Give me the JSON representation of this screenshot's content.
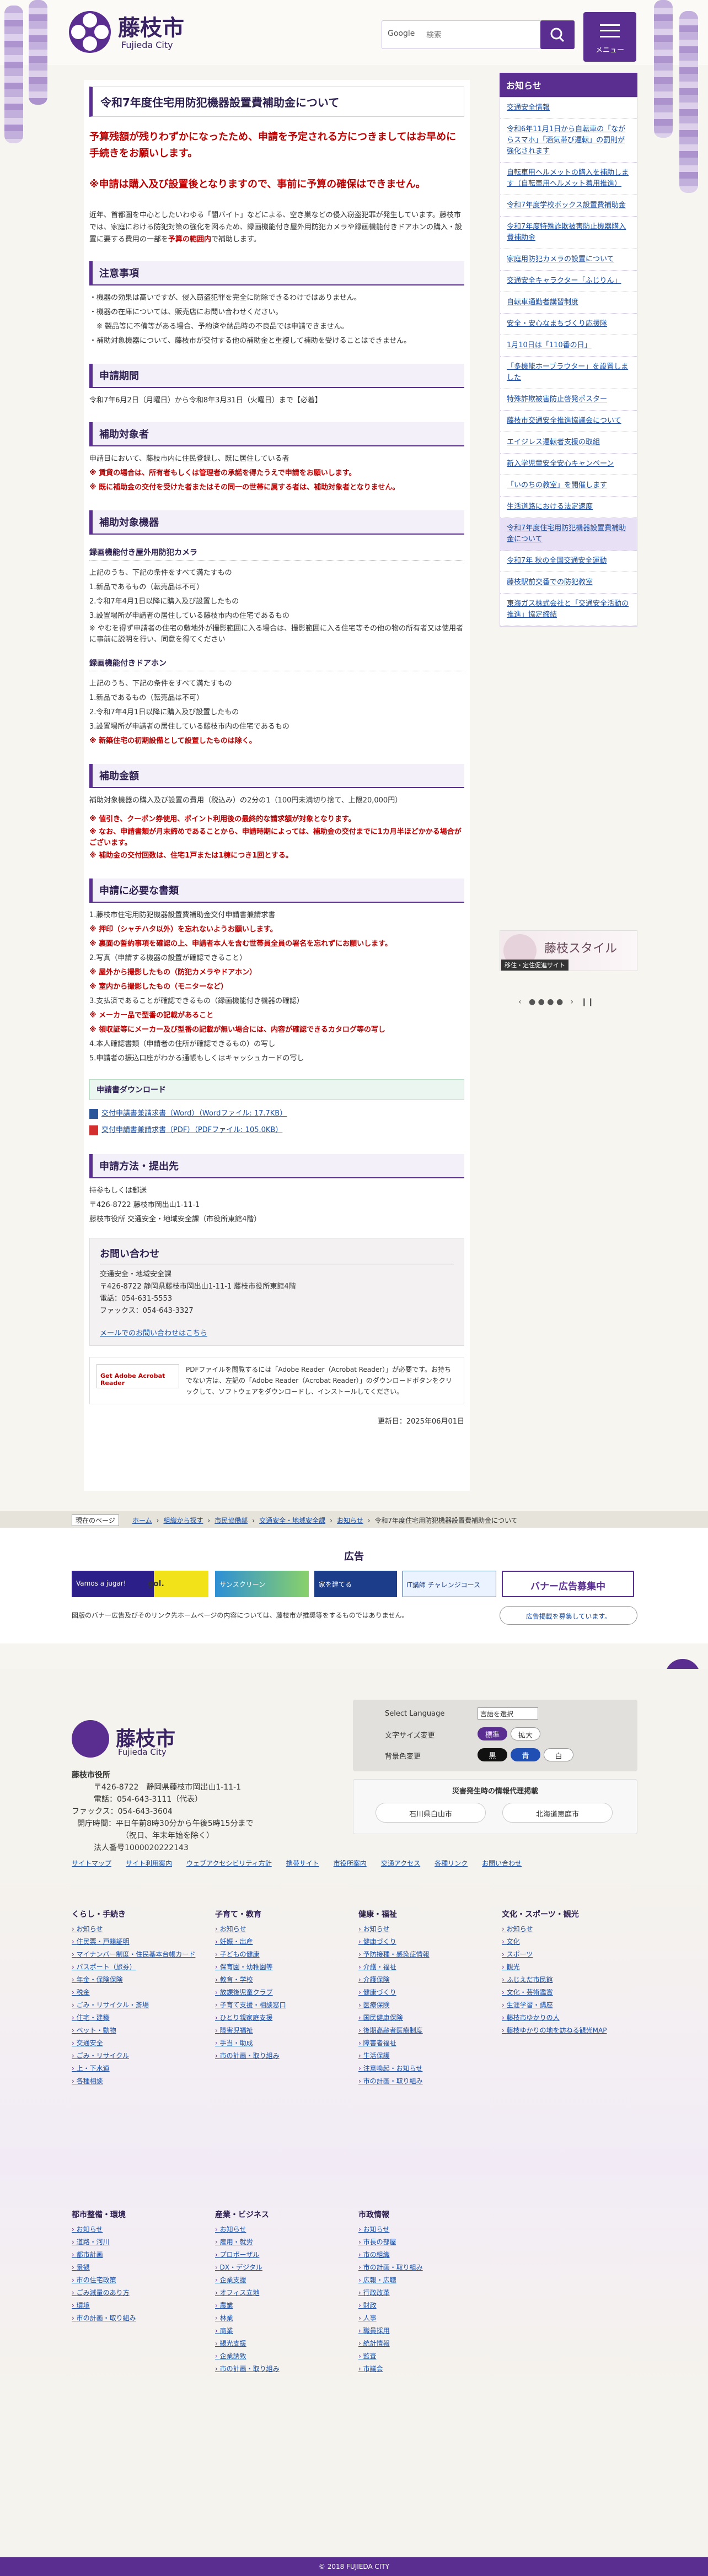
{
  "header": {
    "site_name": "藤枝市",
    "site_name_en": "Fujieda City",
    "search_label": "Google",
    "search_placeholder": "検索",
    "menu_label": "メニュー"
  },
  "article": {
    "title": "令和7年度住宅用防犯機器設置費補助金について",
    "warning1": "予算残額が残りわずかになったため、申請を予定される方につきましてはお早めに手続きをお願いします。",
    "warning2": "※申請は購入及び設置後となりますので、事前に予算の確保はできません。",
    "intro": "近年、首都圏を中心としたいわゆる「闇バイト」などによる、空き巣などの侵入窃盗犯罪が発生しています。藤枝市では、家庭における防犯対策の強化を図るため、録画機能付き屋外用防犯カメラや録画機能付きドアホンの購入・設置に要する費用の一部を",
    "intro_red": "予算の範囲内",
    "intro_end": "で補助します。",
    "caution_h": "注意事項",
    "caution": [
      "・機器の効果は高いですが、侵入窃盗犯罪を完全に防除できるわけではありません。",
      "・機器の在庫については、販売店にお問い合わせください。",
      "　※ 製品等に不備等がある場合、予約済や納品時の不良品では申請できません。",
      "・補助対象機器について、藤枝市が交付する他の補助金と重複して補助を受けることはできません。"
    ],
    "period_h": "申請期間",
    "period": "令和7年6月2日（月曜日）から令和8年3月31日（火曜日）まで【必着】",
    "target_h": "補助対象者",
    "target": [
      "申請日において、藤枝市内に住民登録し、既に居住している者",
      "※ 賃貸の場合は、所有者もしくは管理者の承諾を得たうえで申請をお願いします。",
      "※ 既に補助金の交付を受けた者またはその同一の世帯に属する者は、補助対象者となりません。"
    ],
    "device_h": "補助対象機器",
    "camera_h": "録画機能付き屋外用防犯カメラ",
    "camera": [
      "上記のうち、下記の条件をすべて満たすもの",
      "1.新品であるもの（転売品は不可）",
      "2.令和7年4月1日以降に購入及び設置したもの",
      "3.設置場所が申請者の居住している藤枝市内の住宅であるもの",
      "※ やむを得ず申請者の住宅の敷地外が撮影範囲に入る場合は、撮影範囲に入る住宅等その他の物の所有者又は使用者に事前に説明を行い、同意を得てください"
    ],
    "door_h": "録画機能付きドアホン",
    "door": [
      "上記のうち、下記の条件をすべて満たすもの",
      "1.新品であるもの（転売品は不可）",
      "2.令和7年4月1日以降に購入及び設置したもの",
      "3.設置場所が申請者の居住している藤枝市内の住宅であるもの"
    ],
    "door_red": "※ 新築住宅の初期設備として設置したものは除く。",
    "amount_h": "補助金額",
    "amount": "補助対象機器の購入及び設置の費用（税込み）の2分の1（100円未満切り捨て、上限20,000円）",
    "amount_notes": [
      "※ 値引き、クーポン券使用、ポイント利用後の最終的な請求額が対象となります。",
      "※ なお、申請書類が月末締めであることから、申請時期によっては、補助金の交付までに1カ月半ほどかかる場合がございます。",
      "※ 補助金の交付回数は、住宅1戸または1棟につき1回とする。"
    ],
    "docs_h": "申請に必要な書類",
    "docs": [
      "1.藤枝市住宅用防犯機器設置費補助金交付申請書兼請求書",
      "※ 押印（シャチハタ以外）を忘れないようお願いします。",
      "※ 裏面の誓約事項を確認の上、申請者本人を含む世帯員全員の署名を忘れずにお願いします。",
      "2.写真（申請する機器の設置が確認できること）",
      "※ 屋外から撮影したもの（防犯カメラやドアホン）",
      "※ 室内から撮影したもの（モニターなど）",
      "3.支払済であることが確認できるもの（録画機能付き機器の確認）",
      "※ メーカー品で型番の記載があること",
      "※ 領収証等にメーカー及び型番の記載が無い場合には、内容が確認できるカタログ等の写し",
      "4.本人確認書類（申請者の住所が確認できるもの）の写し",
      "5.申請者の振込口座がわかる通帳もしくはキャッシュカードの写し"
    ],
    "dl_h": "申請書ダウンロード",
    "dl": [
      "交付申請書兼請求書（Word）（Wordファイル: 17.7KB）",
      "交付申請書兼請求書（PDF）（PDFファイル: 105.0KB）"
    ],
    "submit_h": "申請方法・提出先",
    "submit": [
      "持参もしくは郵送",
      "〒426-8722 藤枝市岡出山1-11-1",
      "藤枝市役所 交通安全・地域安全課（市役所東館4階）"
    ],
    "contact_h": "お問い合わせ",
    "contact": [
      "交通安全・地域安全課",
      "〒426-8722 静岡県藤枝市岡出山1-11-1 藤枝市役所東館4階",
      "電話：054-631-5553",
      "ファックス：054-643-3327"
    ],
    "contact_link": "メールでのお問い合わせはこちら",
    "adobe_text": "PDFファイルを閲覧するには「Adobe Reader（Acrobat Reader）」が必要です。お持ちでない方は、左記の「Adobe Reader（Acrobat Reader）」のダウンロードボタンをクリックして、ソフトウェアをダウンロードし、インストールしてください。",
    "adobe_badge": "Get Adobe Acrobat Reader",
    "updated": "更新日：2025年06月01日"
  },
  "sidebar": {
    "heading": "お知らせ",
    "items": [
      "交通安全情報",
      "令和6年11月1日から自転車の「ながらスマホ」「酒気帯び運転」の罰則が強化されます",
      "自転車用ヘルメットの購入を補助します（自転車用ヘルメット着用推進）",
      "令和7年度学校ボックス設置費補助金",
      "令和7年度特殊詐欺被害防止機器購入費補助金",
      "家庭用防犯カメラの設置について",
      "交通安全キャラクター「ふじりん」",
      "自転車通勤者講習制度",
      "安全・安心なまちづくり応援隊",
      "1月10日は「110番の日」",
      "「多機能ホーブラウター」を設置しました",
      "特殊詐欺被害防止啓発ポスター",
      "藤枝市交通安全推進協議会について",
      "エイジレス運転者支援の取組",
      "新入学児童安全安心キャンペーン",
      "「いのちの教室」を開催します",
      "生活道路における法定速度",
      "令和7年度住宅用防犯機器設置費補助金について",
      "令和7年 秋の全国交通安全運動",
      "藤枝駅前交番での防犯教室",
      "東海ガス株式会社と「交通安全活動の推進」協定締結"
    ],
    "banner_title": "藤枝スタイル",
    "banner_sub": "移住・定住促進サイト"
  },
  "breadcrumb": {
    "here": "現在のページ",
    "items": [
      "ホーム",
      "組織から探す",
      "市民協働部",
      "交通安全・地域安全課",
      "お知らせ",
      "令和7年度住宅用防犯機器設置費補助金について"
    ]
  },
  "ads": {
    "heading": "広告",
    "note": "図版のバナー広告及びそのリンク先ホームページの内容については、藤枝市が推奨等をするものではありません。",
    "apply_button": "広告掲載を募集しています。",
    "banner_slots": [
      "Vamos a jugar!",
      "gol.",
      "サンスクリーン",
      "家を建てる",
      "IT講師 チャレンジコース",
      "バナー広告募集中"
    ]
  },
  "footer": {
    "city": "藤枝市役所",
    "address_label": "所在地",
    "address": "〒426-8722　静岡県藤枝市岡出山1-11-1",
    "tel": "電話：054-643-3111（代表）",
    "fax": "ファックス：054-643-3604",
    "hours": "開庁時間：平日午前8時30分から午後5時15分まで",
    "hours2": "（祝日、年末年始を除く）",
    "corp_no": "法人番号1000020222143",
    "lang_label": "Select Language",
    "lang_value": "言語を選択",
    "fontsize_label": "文字サイズ変更",
    "fontsize_std": "標準",
    "fontsize_big": "拡大",
    "bg_label": "背景色変更",
    "bg_black": "黒",
    "bg_blue": "青",
    "bg_white": "白",
    "disaster_title": "災害発生時の情報代理掲載",
    "disaster_links": [
      "石川県白山市",
      "北海道恵庭市"
    ],
    "links": [
      "サイトマップ",
      "サイト利用案内",
      "ウェブアクセシビリティ方針",
      "携帯サイト",
      "市役所案内",
      "交通アクセス",
      "各種リンク",
      "お問い合わせ"
    ],
    "copyright": "© 2018 FUJIEDA CITY",
    "cols": [
      {
        "h": "くらし・手続き",
        "items": [
          "お知らせ",
          "住民票・戸籍証明",
          "マイナンバー制度・住民基本台帳カード",
          "パスポート（旅券）",
          "年金・保険保険",
          "税金",
          "ごみ・リサイクル・斎場",
          "住宅・建築",
          "ペット・動物",
          "交通安全",
          "ごみ・リサイクル",
          "上・下水道",
          "各種相談"
        ]
      },
      {
        "h": "子育て・教育",
        "items": [
          "お知らせ",
          "妊娠・出産",
          "子どもの健康",
          "保育園・幼稚園等",
          "教育・学校",
          "放課後児童クラブ",
          "子育て支援・相談窓口",
          "ひとり親家庭支援",
          "障害児福祉",
          "手当・助成",
          "市の計画・取り組み"
        ]
      },
      {
        "h": "健康・福祉",
        "items": [
          "お知らせ",
          "健康づくり",
          "予防接種・感染症情報",
          "介護・福祉",
          "介護保険",
          "健康づくり",
          "医療保険",
          "国民健康保険",
          "後期高齢者医療制度",
          "障害者福祉",
          "生活保護",
          "注意喚起・お知らせ",
          "市の計画・取り組み"
        ]
      },
      {
        "h": "文化・スポーツ・観光",
        "items": [
          "お知らせ",
          "文化",
          "スポーツ",
          "観光",
          "ふじえだ市民館",
          "文化・芸術鑑賞",
          "生涯学習・講座",
          "藤枝市ゆかりの人",
          "藤枝ゆかりの地を訪ねる観光MAP"
        ]
      },
      {
        "h": "都市整備・環境",
        "items": [
          "お知らせ",
          "道路・河川",
          "都市計画",
          "景観",
          "市の住宅政策",
          "ごみ減量のあり方",
          "環境",
          "市の計画・取り組み"
        ]
      },
      {
        "h": "産業・ビジネス",
        "items": [
          "お知らせ",
          "雇用・就労",
          "プロポーザル",
          "DX・デジタル",
          "企業支援",
          "オフィス立地",
          "農業",
          "林業",
          "商業",
          "観光支援",
          "企業誘致",
          "市の計画・取り組み"
        ]
      },
      {
        "h": "市政情報",
        "items": [
          "お知らせ",
          "市長の部屋",
          "市の組織",
          "市の計画・取り組み",
          "広報・広聴",
          "行政改革",
          "財政",
          "人事",
          "職員採用",
          "統計情報",
          "監査",
          "市議会"
        ]
      }
    ]
  },
  "colors": {
    "brand": "#5a2e91",
    "warning": "#c00000",
    "link": "#1a4fa8"
  }
}
